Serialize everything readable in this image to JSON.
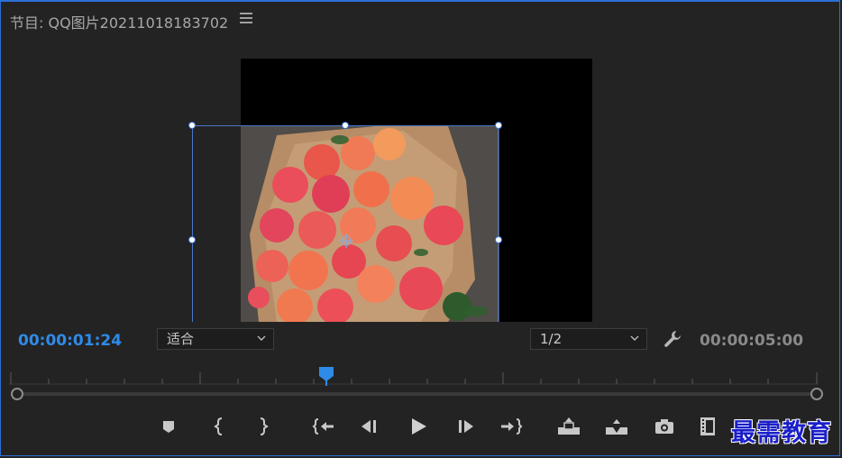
{
  "panel": {
    "title": "节目: QQ图片20211018183702",
    "current_timecode": "00:00:01:24",
    "total_timecode": "00:00:05:00",
    "zoom_select": "适合",
    "resolution_select": "1/2",
    "playhead_position": 0.4
  },
  "controls": [
    {
      "name": "add-marker-button",
      "icon": "marker-icon"
    },
    {
      "name": "mark-in-button",
      "icon": "mark-in-icon"
    },
    {
      "name": "mark-out-button",
      "icon": "mark-out-icon"
    },
    {
      "name": "go-to-in-button",
      "icon": "go-to-in-icon"
    },
    {
      "name": "step-back-button",
      "icon": "step-back-icon"
    },
    {
      "name": "play-button",
      "icon": "play-icon"
    },
    {
      "name": "step-forward-button",
      "icon": "step-forward-icon"
    },
    {
      "name": "go-to-out-button",
      "icon": "go-to-out-icon"
    },
    {
      "name": "lift-button",
      "icon": "lift-icon"
    },
    {
      "name": "extract-button",
      "icon": "extract-icon"
    },
    {
      "name": "export-frame-button",
      "icon": "camera-icon"
    },
    {
      "name": "insert-button",
      "icon": "insert-icon"
    }
  ],
  "watermark": "最需教育",
  "colors": {
    "accent": "#2f8be8",
    "frame": "#2d6fd6",
    "background": "#232323"
  }
}
